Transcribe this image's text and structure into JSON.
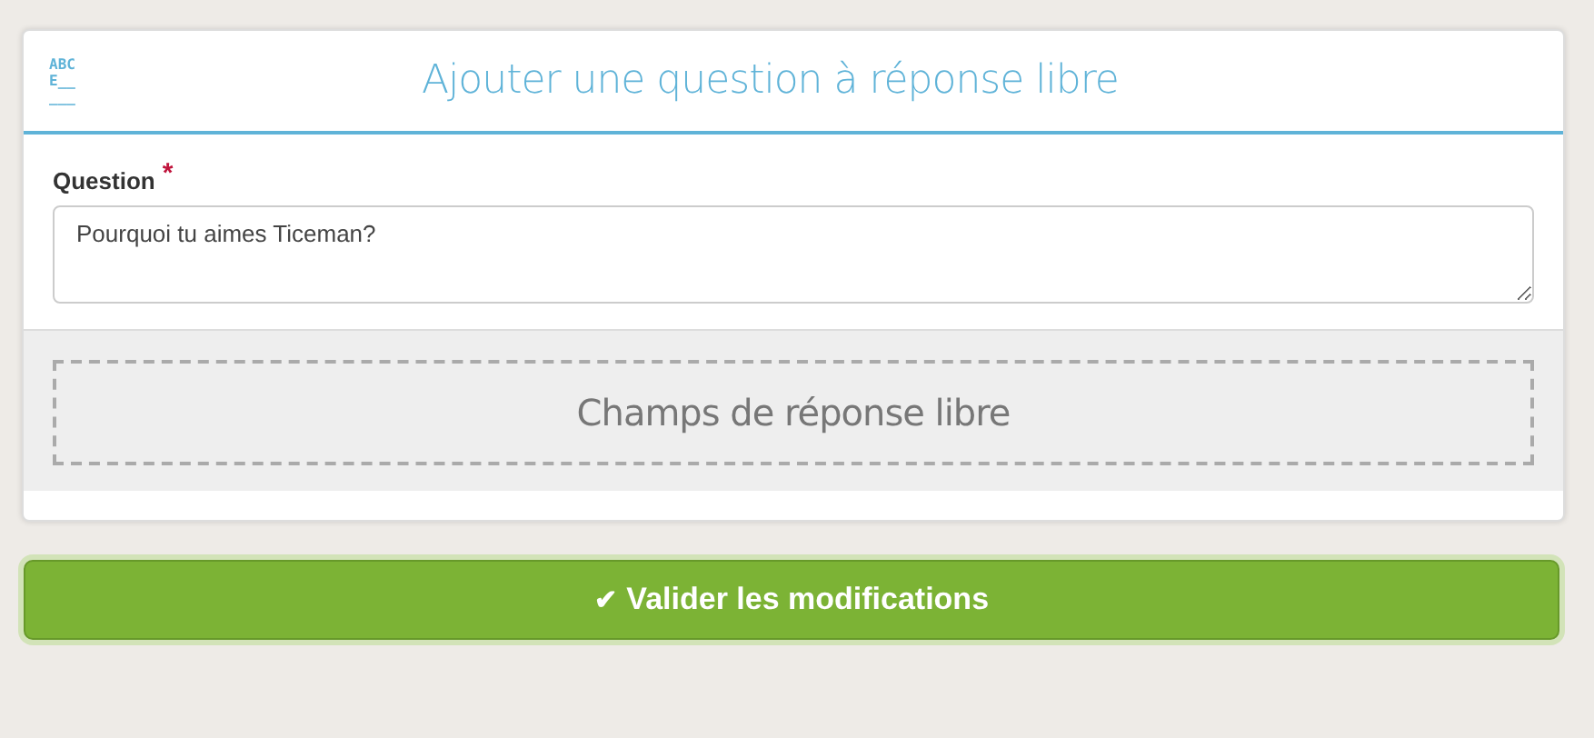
{
  "header": {
    "icon_lines": [
      "ABC",
      "E__",
      "___"
    ],
    "title": "Ajouter une question à réponse libre"
  },
  "question": {
    "label": "Question",
    "required_mark": "*",
    "value": "Pourquoi tu aimes Ticeman?"
  },
  "answer_zone": {
    "label": "Champs de réponse libre"
  },
  "submit": {
    "icon": "✔",
    "label": "Valider les modifications"
  }
}
